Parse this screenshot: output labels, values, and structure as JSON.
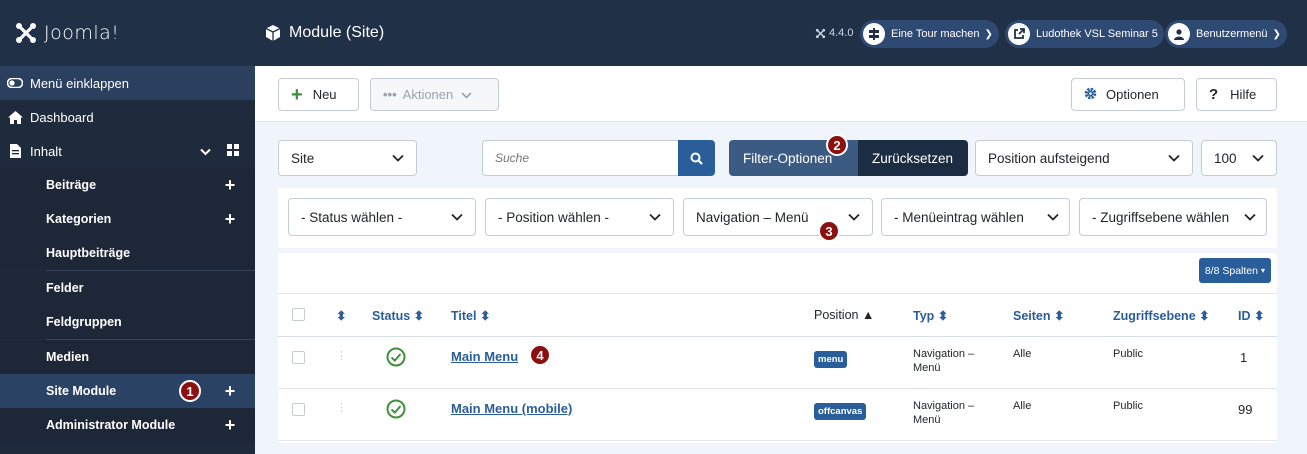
{
  "sidebar": {
    "brand": "Joomla!",
    "collapse_label": "Menü einklappen",
    "dashboard_label": "Dashboard",
    "content_label": "Inhalt",
    "items": [
      {
        "label": "Beiträge",
        "has_add": true
      },
      {
        "label": "Kategorien",
        "has_add": true
      },
      {
        "label": "Hauptbeiträge",
        "has_add": false
      },
      {
        "label": "Felder",
        "has_add": false
      },
      {
        "label": "Feldgruppen",
        "has_add": false
      },
      {
        "label": "Medien",
        "has_add": false
      },
      {
        "label": "Site Module",
        "has_add": true,
        "active": true
      },
      {
        "label": "Administrator Module",
        "has_add": true
      }
    ]
  },
  "header": {
    "title": "Module (Site)",
    "version": "4.4.0",
    "tour_label": "Eine Tour machen",
    "site_label": "Ludothek VSL Seminar 5",
    "user_label": "Benutzermenü"
  },
  "toolbar": {
    "new_label": "Neu",
    "actions_label": "Aktionen",
    "options_label": "Optionen",
    "help_label": "Hilfe"
  },
  "filters": {
    "client_value": "Site",
    "search_placeholder": "Suche",
    "filter_options_label": "Filter-Optionen",
    "reset_label": "Zurücksetzen",
    "sort_value": "Position aufsteigend",
    "limit_value": "100",
    "status_value": "- Status wählen -",
    "position_value": "- Position wählen -",
    "type_value": "Navigation – Menü",
    "menuitem_value": "- Menüeintrag wählen",
    "access_value": "- Zugriffsebene wählen"
  },
  "markers": [
    "1",
    "2",
    "3",
    "4"
  ],
  "table": {
    "columns_button": "8/8 Spalten",
    "headers": {
      "status": "Status",
      "title": "Titel",
      "position": "Position",
      "type": "Typ",
      "pages": "Seiten",
      "access": "Zugriffsebene",
      "id": "ID"
    },
    "rows": [
      {
        "title": "Main Menu",
        "position": "menu",
        "type_line1": "Navigation –",
        "type_line2": "Menü",
        "pages": "Alle",
        "access": "Public",
        "id": "1"
      },
      {
        "title": "Main Menu (mobile)",
        "position": "offcanvas",
        "type_line1": "Navigation –",
        "type_line2": "Menü",
        "pages": "Alle",
        "access": "Public",
        "id": "99"
      }
    ]
  },
  "colors": {
    "sidebar_bg": "#1f2a3c",
    "header_bg": "#1f3047",
    "accent": "#2a5e9a",
    "marker": "#8b1010",
    "status_ok": "#3f8f3c"
  }
}
